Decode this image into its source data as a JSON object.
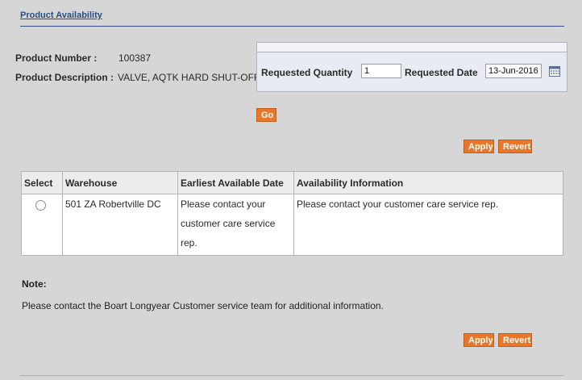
{
  "section_title": "Product Availability",
  "product": {
    "number_label": "Product Number :",
    "number_value": "100387",
    "description_label": "Product Description :",
    "description_value": "VALVE, AQTK HARD SHUT-OFF"
  },
  "request": {
    "quantity_label": "Requested Quantity",
    "quantity_value": "1",
    "date_label": "Requested Date",
    "date_value": "13-Jun-2016",
    "calendar_icon": "calendar-icon"
  },
  "buttons": {
    "go": "Go",
    "apply": "Apply",
    "revert": "Revert"
  },
  "table": {
    "headers": [
      "Select",
      "Warehouse",
      "Earliest Available Date",
      "Availability Information"
    ],
    "rows": [
      {
        "warehouse": "501 ZA Robertville DC",
        "earliest_line1": "Please contact your",
        "earliest_line2": "customer care service",
        "earliest_line3": "rep.",
        "info": "Please contact your customer care service rep."
      }
    ]
  },
  "note": {
    "heading": "Note:",
    "text": "Please contact the Boart Longyear Customer service team for additional information."
  },
  "colors": {
    "accent": "#e8772a",
    "title": "#2c4a86",
    "background": "#d6d6d6"
  }
}
